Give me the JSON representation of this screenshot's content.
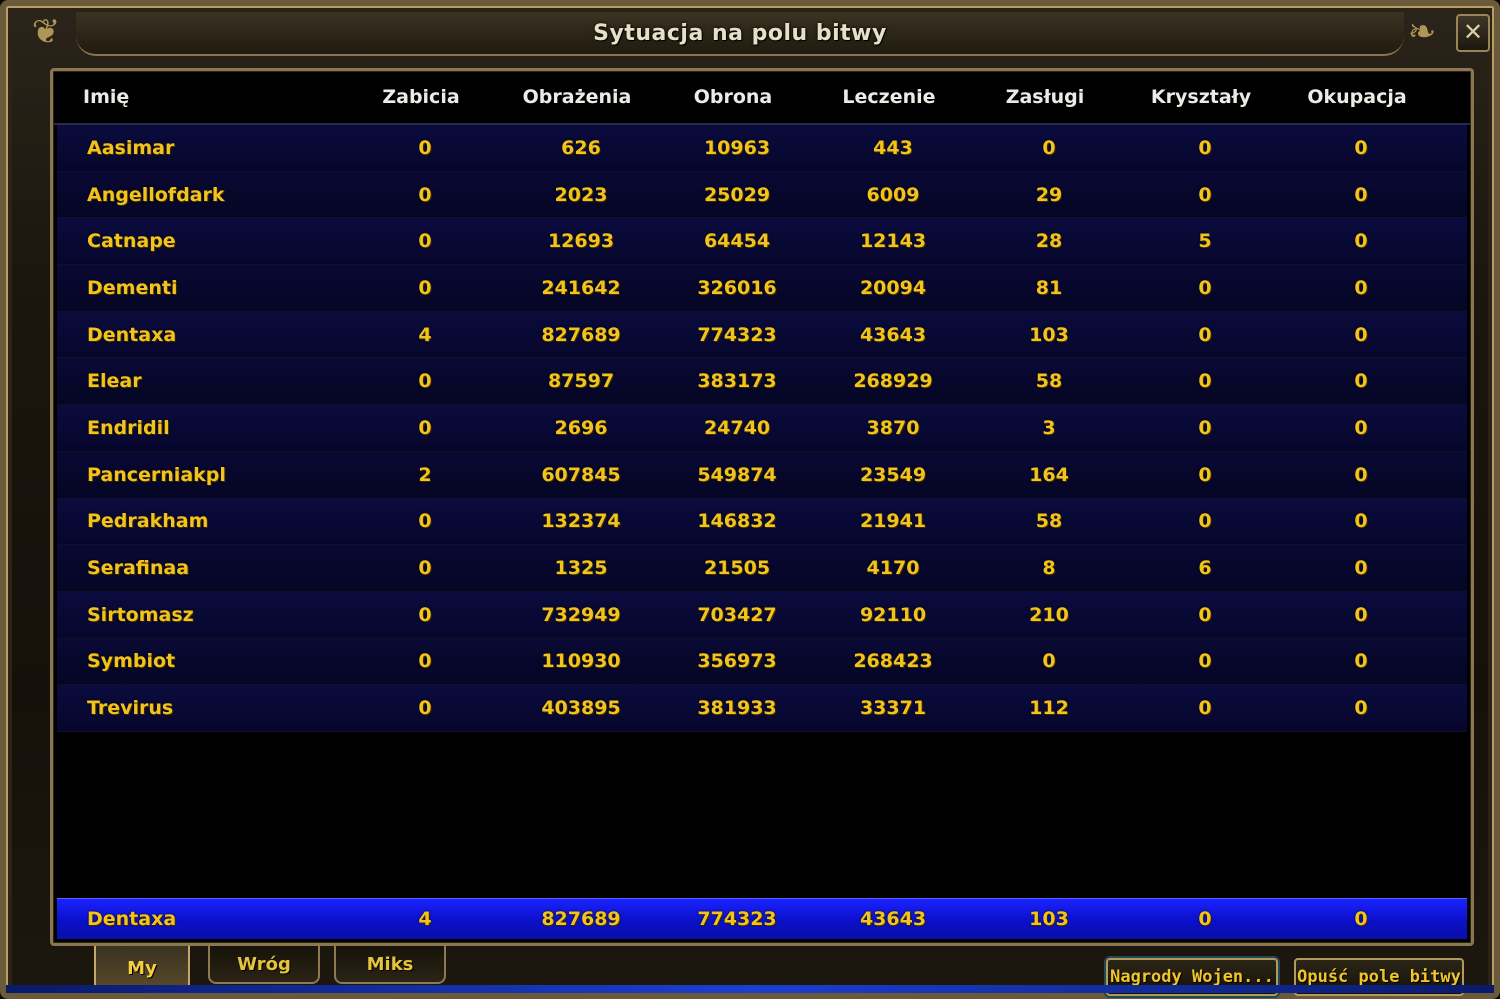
{
  "window": {
    "title": "Sytuacja na polu bitwy",
    "close_icon": "close-icon"
  },
  "columns": [
    "Imię",
    "Zabicia",
    "Obrażenia",
    "Obrona",
    "Leczenie",
    "Zasługi",
    "Kryształy",
    "Okupacja"
  ],
  "rows": [
    [
      "Aasimar",
      "0",
      "626",
      "10963",
      "443",
      "0",
      "0",
      "0"
    ],
    [
      "Angellofdark",
      "0",
      "2023",
      "25029",
      "6009",
      "29",
      "0",
      "0"
    ],
    [
      "Catnape",
      "0",
      "12693",
      "64454",
      "12143",
      "28",
      "5",
      "0"
    ],
    [
      "Dementi",
      "0",
      "241642",
      "326016",
      "20094",
      "81",
      "0",
      "0"
    ],
    [
      "Dentaxa",
      "4",
      "827689",
      "774323",
      "43643",
      "103",
      "0",
      "0"
    ],
    [
      "Elear",
      "0",
      "87597",
      "383173",
      "268929",
      "58",
      "0",
      "0"
    ],
    [
      "Endridil",
      "0",
      "2696",
      "24740",
      "3870",
      "3",
      "0",
      "0"
    ],
    [
      "Pancerniakpl",
      "2",
      "607845",
      "549874",
      "23549",
      "164",
      "0",
      "0"
    ],
    [
      "Pedrakham",
      "0",
      "132374",
      "146832",
      "21941",
      "58",
      "0",
      "0"
    ],
    [
      "Serafinaa",
      "0",
      "1325",
      "21505",
      "4170",
      "8",
      "6",
      "0"
    ],
    [
      "Sirtomasz",
      "0",
      "732949",
      "703427",
      "92110",
      "210",
      "0",
      "0"
    ],
    [
      "Symbiot",
      "0",
      "110930",
      "356973",
      "268423",
      "0",
      "0",
      "0"
    ],
    [
      "Trevirus",
      "0",
      "403895",
      "381933",
      "33371",
      "112",
      "0",
      "0"
    ]
  ],
  "self_row": [
    "Dentaxa",
    "4",
    "827689",
    "774323",
    "43643",
    "103",
    "0",
    "0"
  ],
  "tabs": {
    "my": "My",
    "enemy": "Wróg",
    "mixed": "Miks",
    "active": "My"
  },
  "buttons": {
    "rewards": "Nagrody Wojen...",
    "leave": "Opuść pole bitwy"
  },
  "colors": {
    "text_gold": "#f2c21d",
    "header_text": "#ecebe6",
    "row_bg": "#0b0b3e",
    "self_row_bg": "#1a23ff",
    "frame": "#8a7650"
  }
}
